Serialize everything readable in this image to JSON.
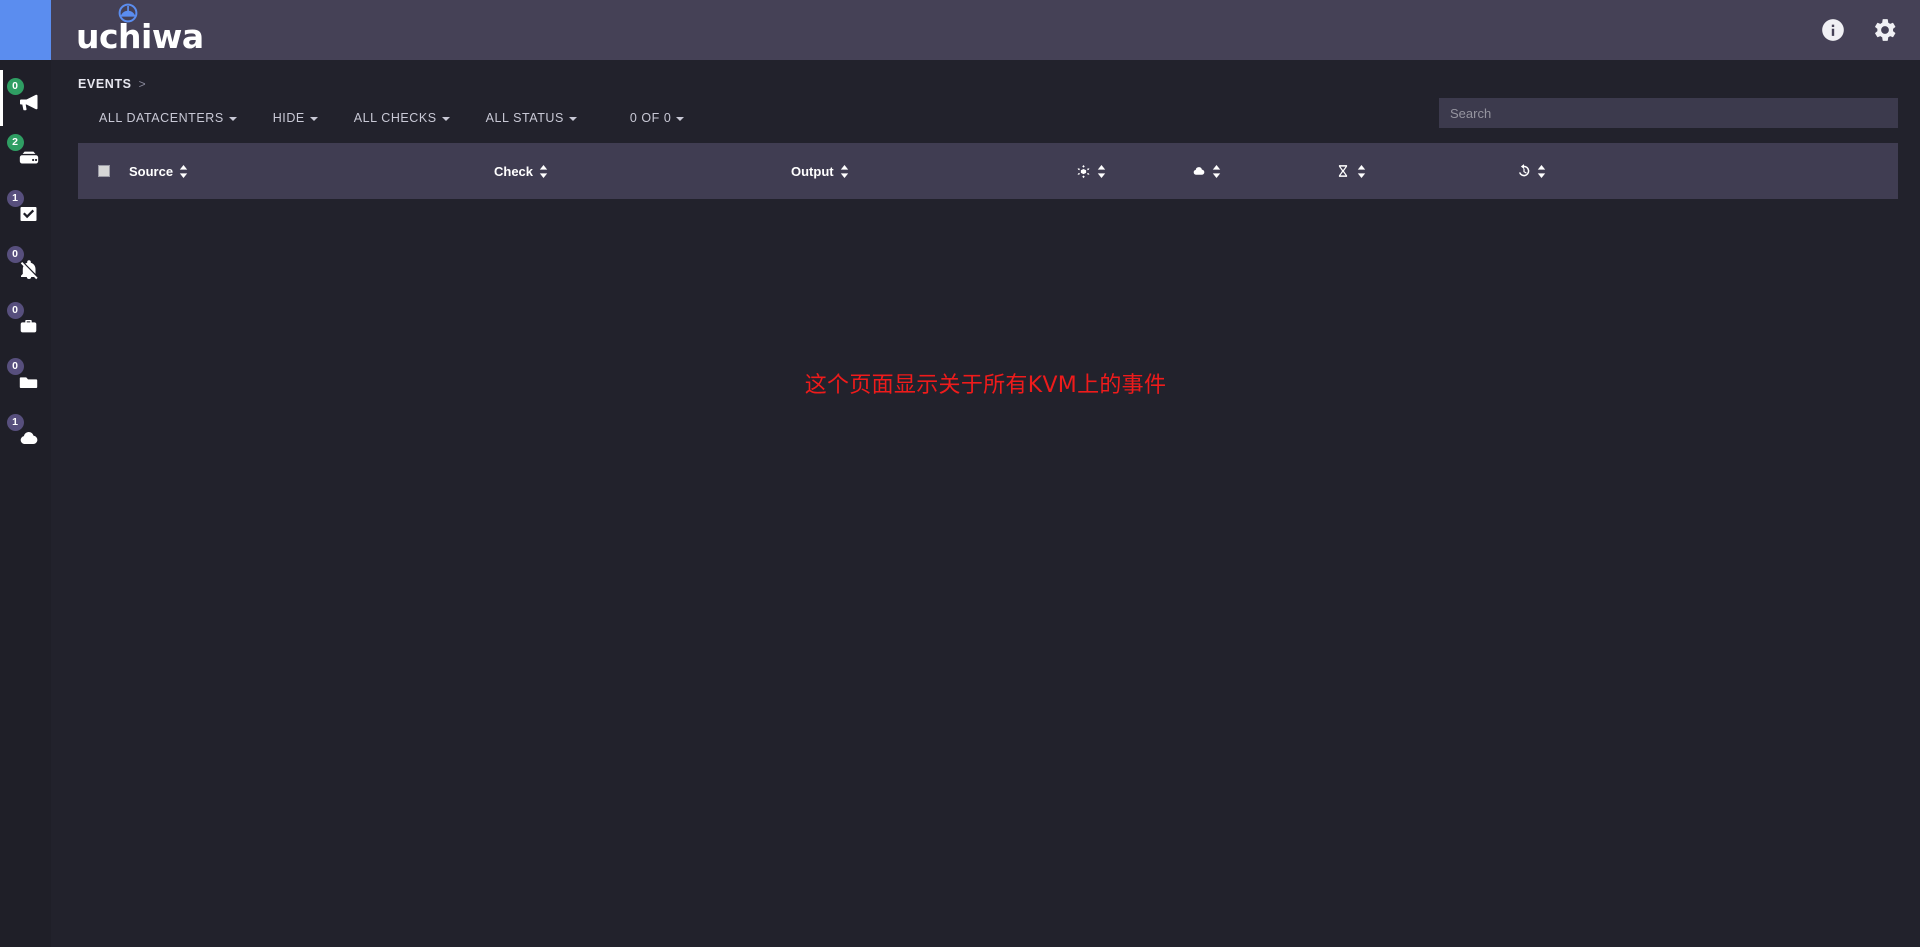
{
  "colors": {
    "accent_blue": "#5b8def",
    "topbar_bg": "#454156",
    "sidebar_bg": "#1f1f28",
    "page_bg": "#22222c",
    "table_head_bg": "#403d52",
    "badge_green": "#2f9e63",
    "badge_purple": "#574f7d",
    "message_red": "#ef1b1b"
  },
  "topbar": {
    "logo_text": "uchiwa",
    "logo_icon": "umbrella-icon",
    "info_icon": "info-circle-icon",
    "settings_icon": "gear-icon"
  },
  "sidebar": {
    "items": [
      {
        "badge": "0",
        "badge_color": "green",
        "icon": "megaphone-icon",
        "name": "events",
        "active": true
      },
      {
        "badge": "2",
        "badge_color": "green",
        "icon": "server-icon",
        "name": "clients",
        "active": false
      },
      {
        "badge": "1",
        "badge_color": "purple",
        "icon": "check-icon",
        "name": "checks",
        "active": false
      },
      {
        "badge": "0",
        "badge_color": "purple",
        "icon": "bell-slash-icon",
        "name": "silenced",
        "active": false
      },
      {
        "badge": "0",
        "badge_color": "purple",
        "icon": "briefcase-icon",
        "name": "aggregates",
        "active": false
      },
      {
        "badge": "0",
        "badge_color": "purple",
        "icon": "folder-icon",
        "name": "datacenters",
        "active": false
      },
      {
        "badge": "1",
        "badge_color": "purple",
        "icon": "cloud-icon",
        "name": "cloud",
        "active": false
      }
    ]
  },
  "breadcrumb": {
    "items": [
      "EVENTS"
    ],
    "separator": ">"
  },
  "filters": [
    {
      "label": "ALL DATACENTERS",
      "name": "filter-datacenters"
    },
    {
      "label": "HIDE",
      "name": "filter-hide"
    },
    {
      "label": "ALL CHECKS",
      "name": "filter-checks"
    },
    {
      "label": "ALL STATUS",
      "name": "filter-status"
    },
    {
      "label": "0 OF 0",
      "name": "filter-pagination"
    }
  ],
  "search": {
    "placeholder": "Search",
    "value": ""
  },
  "table": {
    "columns": [
      {
        "label": "Source",
        "type": "text",
        "sortable": true,
        "name": "column-source"
      },
      {
        "label": "Check",
        "type": "text",
        "sortable": true,
        "name": "column-check"
      },
      {
        "label": "Output",
        "type": "text",
        "sortable": true,
        "name": "column-output"
      },
      {
        "label": "",
        "type": "icon",
        "icon": "snowflake-icon",
        "sortable": true,
        "name": "column-status"
      },
      {
        "label": "",
        "type": "icon",
        "icon": "cloud-icon",
        "sortable": true,
        "name": "column-datacenter"
      },
      {
        "label": "",
        "type": "icon",
        "icon": "hourglass-icon",
        "sortable": true,
        "name": "column-duration"
      },
      {
        "label": "",
        "type": "icon",
        "icon": "history-icon",
        "sortable": true,
        "name": "column-history"
      }
    ],
    "rows": []
  },
  "main": {
    "message": "这个页面显示关于所有KVM上的事件"
  }
}
